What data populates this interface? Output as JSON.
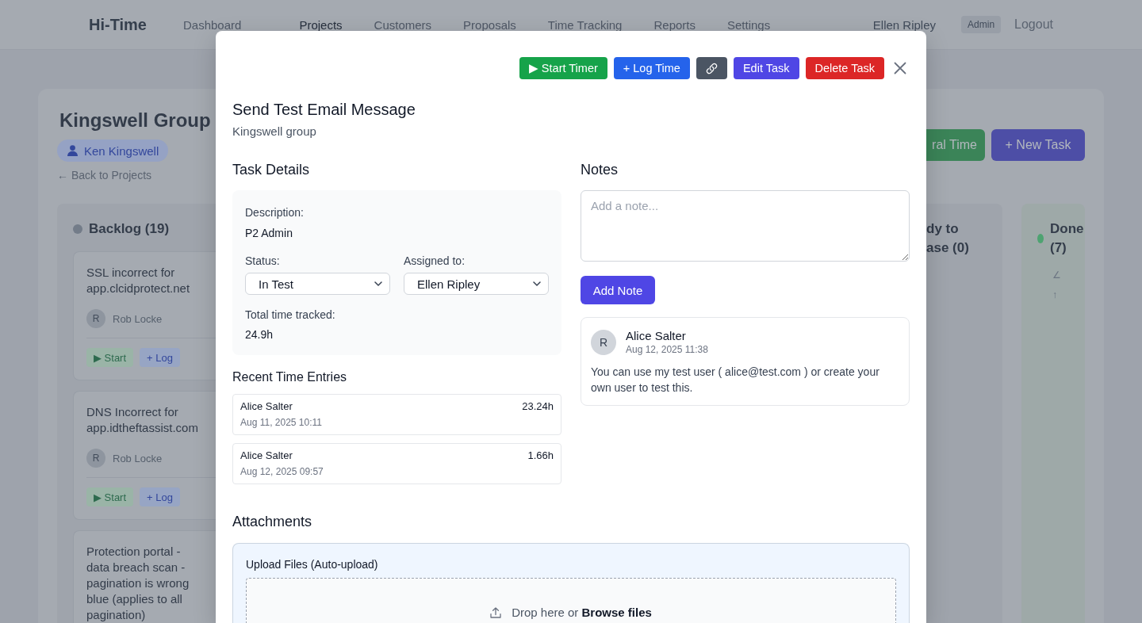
{
  "nav": {
    "brand": "Hi-Time",
    "items": [
      {
        "label": "Dashboard",
        "selected": false
      },
      {
        "label": "Projects",
        "selected": true
      },
      {
        "label": "Customers",
        "selected": false
      },
      {
        "label": "Proposals",
        "selected": false
      },
      {
        "label": "Time Tracking",
        "selected": false
      },
      {
        "label": "Reports",
        "selected": false
      },
      {
        "label": "Settings",
        "selected": false
      }
    ],
    "user": "Ellen Ripley",
    "role": "Admin",
    "logout": "Logout"
  },
  "project": {
    "title": "Kingswell Group",
    "client": "Ken Kingswell",
    "back_link": "← Back to Projects",
    "actions": [
      {
        "label": "ral Time",
        "kind": "log"
      },
      {
        "label": "+ New Task",
        "kind": "create"
      }
    ]
  },
  "board": {
    "columns": [
      {
        "kind": "backlog",
        "title": "Backlog (19)",
        "color": "#737c89",
        "tasks": [
          {
            "title": "SSL incorrect for app.clcidprotect.net",
            "initial": "R",
            "assignee": "Rob Locke",
            "actions": [
              {
                "label": "▶ Start",
                "kind": "start"
              },
              {
                "label": "+ Log",
                "kind": "log"
              }
            ]
          },
          {
            "title": "DNS Incorrect for app.idtheftassist.com",
            "initial": "R",
            "assignee": "Rob Locke",
            "actions": [
              {
                "label": "▶ Start",
                "kind": "start"
              },
              {
                "label": "+ Log",
                "kind": "log"
              }
            ]
          },
          {
            "title": "Protection portal - data breach scan - pagination is wrong blue (applies to all pagination)"
          }
        ]
      },
      {
        "kind": "ready",
        "title": "dy to ase (0)"
      },
      {
        "kind": "done",
        "title": "Done (7)",
        "color": "#4ea371",
        "symbols": [
          "∠",
          "↑"
        ]
      }
    ]
  },
  "task_modal": {
    "actions": [
      {
        "label": "▶ Start Timer",
        "kind": "start"
      },
      {
        "label": "+ Log Time",
        "kind": "log"
      },
      {
        "kind": "link"
      },
      {
        "label": "Edit Task",
        "kind": "edit"
      },
      {
        "label": "Delete Task",
        "kind": "delete"
      }
    ],
    "title": "Send Test Email Message",
    "subtitle": "Kingswell group",
    "details": {
      "heading": "Task Details",
      "description_label": "Description:",
      "description": "P2 Admin",
      "status_label": "Status:",
      "status": "In Test",
      "assigned_label": "Assigned to:",
      "assigned": "Ellen Ripley",
      "total_label": "Total time tracked:",
      "total": "24.9h"
    },
    "time_entries": {
      "heading": "Recent Time Entries",
      "entries": [
        {
          "user": "Alice Salter",
          "date": "Aug 11, 2025 10:11",
          "hours": "23.24h"
        },
        {
          "user": "Alice Salter",
          "date": "Aug 12, 2025 09:57",
          "hours": "1.66h"
        }
      ]
    },
    "notes": {
      "heading": "Notes",
      "placeholder": "Add a note...",
      "button": "Add Note",
      "items": [
        {
          "initial": "R",
          "author": "Alice Salter",
          "date": "Aug 12, 2025 11:38",
          "text": "You can use my test user ( alice@test.com ) or create your own user to test this."
        }
      ]
    },
    "attachments": {
      "heading": "Attachments",
      "upload_label": "Upload Files (Auto-upload)",
      "drop_text": "Drop here or **Browse files**"
    }
  }
}
